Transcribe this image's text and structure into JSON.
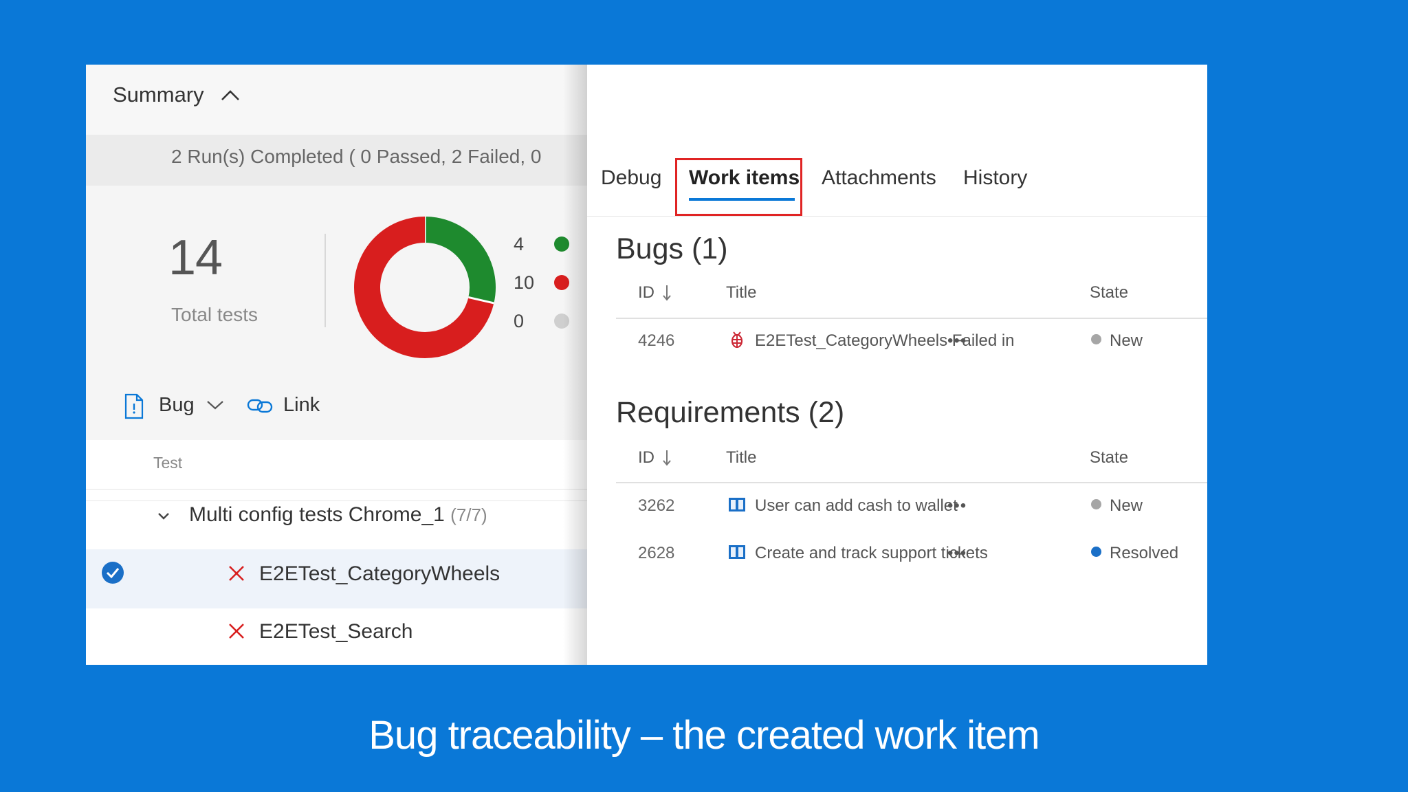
{
  "summary": {
    "title": "Summary",
    "runs_text": "2 Run(s) Completed ( 0 Passed, 2 Failed, 0",
    "total_tests": "14",
    "total_label": "Total tests",
    "legend": [
      {
        "value": "4",
        "color": "#1e8a2e"
      },
      {
        "value": "10",
        "color": "#d81e1e"
      },
      {
        "value": "0",
        "color": "#cfcfcf"
      }
    ]
  },
  "toolbar": {
    "bug_label": "Bug",
    "link_label": "Link"
  },
  "test_list": {
    "column_header": "Test",
    "group_label": "Multi config tests Chrome_1",
    "group_count": "(7/7)",
    "tests": [
      {
        "name": "E2ETest_CategoryWheels",
        "selected": true
      },
      {
        "name": "E2ETest_Search",
        "selected": false
      }
    ]
  },
  "tabs": [
    "Debug",
    "Work items",
    "Attachments",
    "History"
  ],
  "active_tab": "Work items",
  "bugs": {
    "title": "Bugs (1)",
    "col_id": "ID",
    "col_title": "Title",
    "col_state": "State",
    "rows": [
      {
        "id": "4246",
        "title": "E2ETest_CategoryWheels Failed in",
        "more": "•••",
        "state": "New",
        "state_color": "#a6a6a6"
      }
    ]
  },
  "requirements": {
    "title": "Requirements (2)",
    "col_id": "ID",
    "col_title": "Title",
    "col_state": "State",
    "rows": [
      {
        "id": "3262",
        "title": "User can add cash to wallet",
        "more": "•••",
        "state": "New",
        "state_color": "#a6a6a6"
      },
      {
        "id": "2628",
        "title": "Create and track support tickets",
        "more": "•••",
        "state": "Resolved",
        "state_color": "#1a6fc7"
      }
    ]
  },
  "caption": "Bug traceability – the created work item"
}
